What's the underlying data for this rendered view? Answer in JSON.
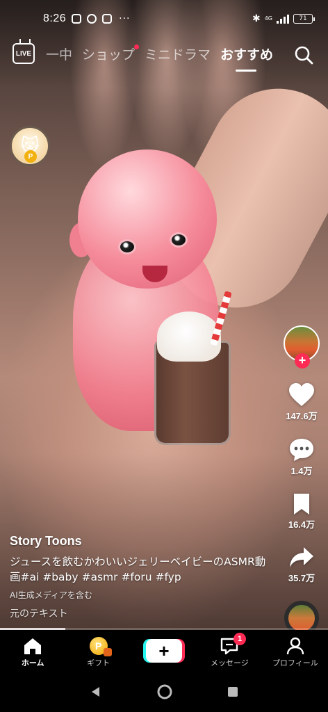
{
  "status": {
    "time": "8:26",
    "dots": "···",
    "network": "4G",
    "battery": "71"
  },
  "topnav": {
    "live_label": "LIVE",
    "tabs": [
      {
        "label": "一中"
      },
      {
        "label": "ショップ",
        "dot": true
      },
      {
        "label": "ミニドラマ"
      },
      {
        "label": "おすすめ",
        "active": true
      }
    ]
  },
  "coin": {
    "badge": "P"
  },
  "actions": {
    "likes": "147.6万",
    "comments": "1.4万",
    "saves": "16.4万",
    "shares": "35.7万"
  },
  "caption": {
    "author": "Story Toons",
    "description": "ジュースを飲むかわいいジェリーベイビーのASMR動画#ai #baby #asmr #foru #fyp",
    "ai_label": "AI生成メディアを含む",
    "original_text": "元のテキスト"
  },
  "progress": 0.2,
  "bottomnav": {
    "home": "ホーム",
    "gift": "ギフト",
    "create": "+",
    "messages": "メッセージ",
    "messages_badge": "1",
    "profile": "プロフィール"
  },
  "colors": {
    "accent": "#ff2b55",
    "cyan": "#25f4ee"
  }
}
